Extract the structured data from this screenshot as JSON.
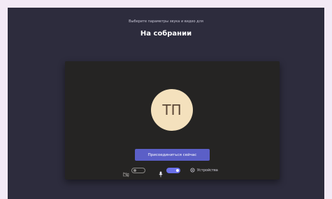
{
  "header": {
    "subtitle": "Выберите параметры звука и видео для",
    "title": "На собрании"
  },
  "preview": {
    "avatar_initials": "ТП"
  },
  "actions": {
    "join_label": "Присоединиться сейчас"
  },
  "controls": {
    "camera_on": false,
    "mic_on": true,
    "devices_label": "Устройства"
  },
  "colors": {
    "background": "#2d2c3d",
    "preview": "#252423",
    "accent": "#5b5fc7",
    "avatar": "#f4e1bd"
  },
  "icons": [
    "camera-off-icon",
    "microphone-icon",
    "gear-icon"
  ]
}
